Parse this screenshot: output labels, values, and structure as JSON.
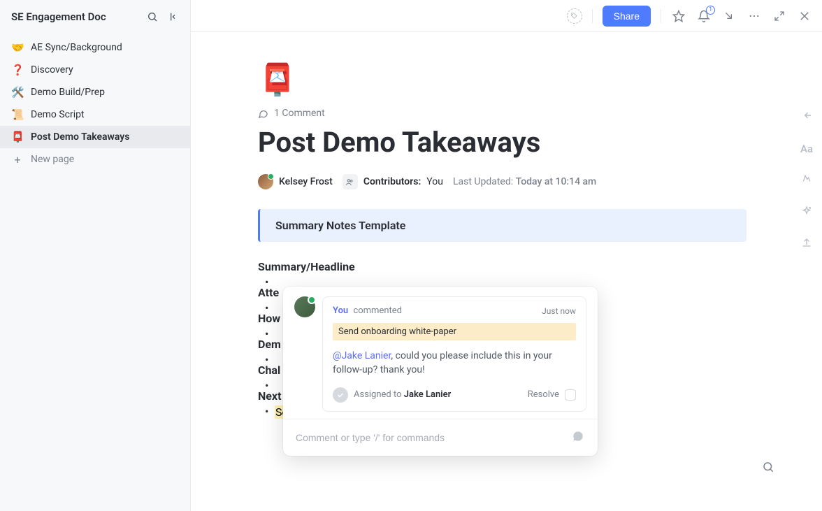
{
  "sidebar": {
    "title": "SE Engagement Doc",
    "items": [
      {
        "emoji": "🤝",
        "label": "AE Sync/Background"
      },
      {
        "emoji": "❓",
        "label": "Discovery"
      },
      {
        "emoji": "🛠️",
        "label": "Demo Build/Prep"
      },
      {
        "emoji": "📜",
        "label": "Demo Script"
      },
      {
        "emoji": "📮",
        "label": "Post Demo Takeaways"
      }
    ],
    "new_page": "New page"
  },
  "topbar": {
    "share": "Share",
    "notif_count": "1"
  },
  "page": {
    "emoji": "📮",
    "comment_count": "1 Comment",
    "title": "Post Demo Takeaways",
    "author": "Kelsey Frost",
    "contributors_label": "Contributors:",
    "contributors_value": "You",
    "updated_label": "Last Updated:",
    "updated_value": "Today at 10:14 am",
    "callout": "Summary Notes Template",
    "sections": {
      "s1": "Summary/Headline",
      "s2": "Atte",
      "s3": "How",
      "s4": "Dem",
      "s5": "Chal",
      "s6": "Next"
    },
    "highlighted_item": "Send onboarding white-paper"
  },
  "comment": {
    "you": "You",
    "commented": "commented",
    "time": "Just now",
    "quote": "Send onboarding white-paper",
    "mention": "@Jake Lanier",
    "message": ", could you please include this in your follow-up? thank you!",
    "assigned_label": "Assigned to",
    "assignee": "Jake Lanier",
    "resolve": "Resolve",
    "input_placeholder": "Comment or type '/' for commands"
  }
}
